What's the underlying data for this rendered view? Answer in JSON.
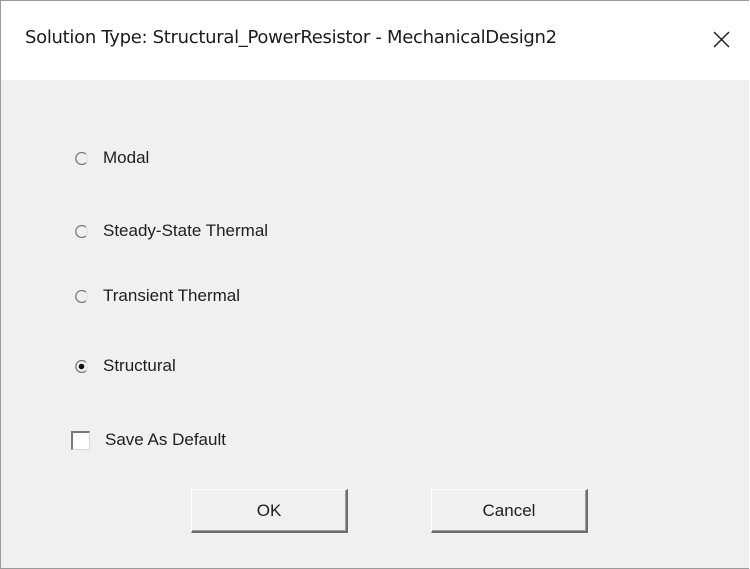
{
  "window": {
    "title": "Solution Type: Structural_PowerResistor - MechanicalDesign2"
  },
  "options": [
    {
      "label": "Modal",
      "selected": false
    },
    {
      "label": "Steady-State Thermal",
      "selected": false
    },
    {
      "label": "Transient Thermal",
      "selected": false
    },
    {
      "label": "Structural",
      "selected": true
    }
  ],
  "save_default": {
    "label": "Save As Default",
    "checked": false
  },
  "buttons": {
    "ok": "OK",
    "cancel": "Cancel"
  },
  "colors": {
    "client_bg": "#f0f0f0",
    "title_bg": "#ffffff",
    "text": "#1e1e1e"
  }
}
